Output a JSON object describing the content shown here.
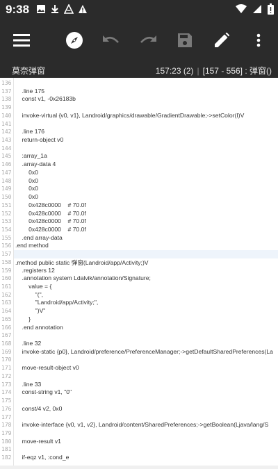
{
  "status": {
    "time": "9:38"
  },
  "toolbar": {
    "menu_icon": "menu-icon",
    "compass_icon": "compass-icon",
    "undo_icon": "undo-icon",
    "redo_icon": "redo-icon",
    "save_icon": "save-icon",
    "edit_icon": "edit-icon",
    "more_icon": "more-vert-icon"
  },
  "subheader": {
    "filename": "莫奈弹窗",
    "cursor_pos": "157:23 (2)",
    "range": "[157 - 556] : 弹窗()"
  },
  "lines": [
    {
      "n": "136",
      "t": ""
    },
    {
      "n": "137",
      "t": "    .line 175"
    },
    {
      "n": "138",
      "t": "    const v1, -0x26183b"
    },
    {
      "n": "139",
      "t": ""
    },
    {
      "n": "140",
      "t": "    invoke-virtual {v0, v1}, Landroid/graphics/drawable/GradientDrawable;->setColor(I)V"
    },
    {
      "n": "141",
      "t": ""
    },
    {
      "n": "142",
      "t": "    .line 176"
    },
    {
      "n": "143",
      "t": "    return-object v0"
    },
    {
      "n": "144",
      "t": ""
    },
    {
      "n": "145",
      "t": "    :array_1a"
    },
    {
      "n": "146",
      "t": "    .array-data 4"
    },
    {
      "n": "147",
      "t": "        0x0"
    },
    {
      "n": "148",
      "t": "        0x0"
    },
    {
      "n": "149",
      "t": "        0x0"
    },
    {
      "n": "150",
      "t": "        0x0"
    },
    {
      "n": "151",
      "t": "        0x428c0000    # 70.0f"
    },
    {
      "n": "152",
      "t": "        0x428c0000    # 70.0f"
    },
    {
      "n": "153",
      "t": "        0x428c0000    # 70.0f"
    },
    {
      "n": "154",
      "t": "        0x428c0000    # 70.0f"
    },
    {
      "n": "155",
      "t": "    .end array-data"
    },
    {
      "n": "156",
      "t": ".end method"
    },
    {
      "n": "157",
      "t": ""
    },
    {
      "n": "158",
      "t": ".method public static 弹窗(Landroid/app/Activity;)V"
    },
    {
      "n": "159",
      "t": "    .registers 12"
    },
    {
      "n": "160",
      "t": "    .annotation system Ldalvik/annotation/Signature;"
    },
    {
      "n": "161",
      "t": "        value = {"
    },
    {
      "n": "162",
      "t": "            \"(\","
    },
    {
      "n": "163",
      "t": "            \"Landroid/app/Activity;\","
    },
    {
      "n": "164",
      "t": "            \")V\""
    },
    {
      "n": "165",
      "t": "        }"
    },
    {
      "n": "166",
      "t": "    .end annotation"
    },
    {
      "n": "167",
      "t": ""
    },
    {
      "n": "168",
      "t": "    .line 32"
    },
    {
      "n": "169",
      "t": "    invoke-static {p0}, Landroid/preference/PreferenceManager;->getDefaultSharedPreferences(La"
    },
    {
      "n": "170",
      "t": ""
    },
    {
      "n": "171",
      "t": "    move-result-object v0"
    },
    {
      "n": "172",
      "t": ""
    },
    {
      "n": "173",
      "t": "    .line 33"
    },
    {
      "n": "174",
      "t": "    const-string v1, \"0\""
    },
    {
      "n": "175",
      "t": ""
    },
    {
      "n": "176",
      "t": "    const/4 v2, 0x0"
    },
    {
      "n": "177",
      "t": ""
    },
    {
      "n": "178",
      "t": "    invoke-interface {v0, v1, v2}, Landroid/content/SharedPreferences;->getBoolean(Ljava/lang/S"
    },
    {
      "n": "179",
      "t": ""
    },
    {
      "n": "180",
      "t": "    move-result v1"
    },
    {
      "n": "181",
      "t": ""
    },
    {
      "n": "182",
      "t": "    if-eqz v1, :cond_e"
    }
  ]
}
